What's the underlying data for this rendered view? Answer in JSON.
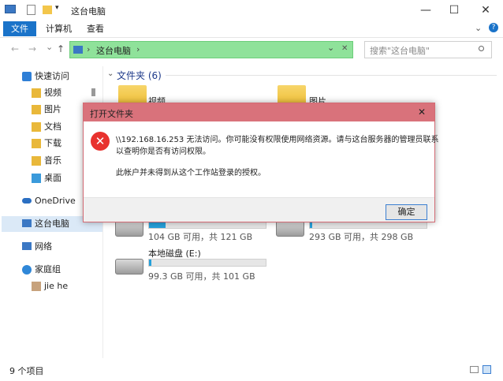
{
  "window": {
    "title": "这台电脑",
    "controls": {
      "minimize": "—",
      "maximize": "☐",
      "close": "✕"
    }
  },
  "ribbon": {
    "tabs": [
      {
        "label": "文件"
      },
      {
        "label": "计算机"
      },
      {
        "label": "查看"
      }
    ],
    "help": "?",
    "expand": "⌄"
  },
  "address": {
    "path": "这台电脑",
    "dropdown": "⌄",
    "clear": "✕",
    "search_placeholder": "搜索\"这台电脑\"",
    "nav": {
      "back": "←",
      "forward": "→",
      "recent": "⌄",
      "up": "↑"
    }
  },
  "nav_pane": {
    "items": [
      {
        "label": "快速访问"
      },
      {
        "label": "视频"
      },
      {
        "label": "图片"
      },
      {
        "label": "文档"
      },
      {
        "label": "下载"
      },
      {
        "label": "音乐"
      },
      {
        "label": "桌面"
      },
      {
        "label": "OneDrive"
      },
      {
        "label": "这台电脑"
      },
      {
        "label": "网络"
      },
      {
        "label": "家庭组"
      },
      {
        "label": "jie he"
      }
    ]
  },
  "content": {
    "folders_header": "文件夹 (6)",
    "folders": [
      {
        "label": "视频"
      },
      {
        "label": "图片"
      }
    ],
    "drives": [
      {
        "label": "",
        "space": "104 GB 可用，共 121 GB",
        "used_fraction": 0.14
      },
      {
        "label": "",
        "space": "293 GB 可用，共 298 GB",
        "used_fraction": 0.02
      },
      {
        "label": "本地磁盘 (E:)",
        "space": "99.3 GB 可用，共 101 GB",
        "used_fraction": 0.02
      }
    ]
  },
  "status": {
    "count": "9 个项目"
  },
  "dialog": {
    "title": "打开文件夹",
    "close": "✕",
    "message_line1": "\\\\192.168.16.253 无法访问。你可能没有权限使用网络资源。请与这台服务器的管理员联系",
    "message_line2": "以查明你是否有访问权限。",
    "message_line3": "此帐户并未得到从这个工作站登录的授权。",
    "ok_label": "确定"
  },
  "colors": {
    "accent": "#1a73c9",
    "dialog_title": "#d9727b",
    "address_bg": "#8fe29a",
    "error": "#e8322e",
    "drive_bar": "#26a0da"
  }
}
